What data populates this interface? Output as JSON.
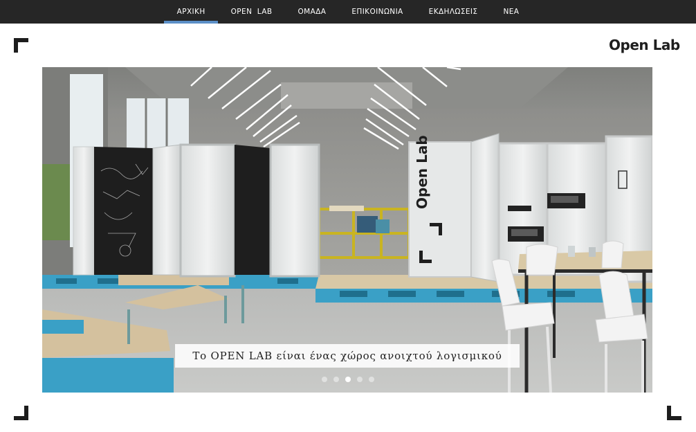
{
  "nav": {
    "items": [
      {
        "label": "ΑΡΧΙΚΗ",
        "active": true
      },
      {
        "label": "OPEN  LAB",
        "active": false
      },
      {
        "label": "ΟΜΑΔΑ",
        "active": false
      },
      {
        "label": "ΕΠΙΚΟΙΝΩΝΙΑ",
        "active": false
      },
      {
        "label": "ΕΚΔΗΛΩΣΕΙΣ",
        "active": false
      },
      {
        "label": "ΝΕΑ",
        "active": false
      }
    ],
    "active_color": "#5b8fc7",
    "background": "#262626"
  },
  "logo": {
    "text": "Open Lab"
  },
  "hero": {
    "caption": "Το OPEN LAB είναι ένας χώρος ανοιχτού λογισμικού",
    "slide_count": 5,
    "active_slide": 3,
    "panel_text": "Open Lab"
  },
  "icons": [
    "corner-bracket-top-left",
    "corner-bracket-bottom-left",
    "corner-bracket-bottom-right"
  ]
}
